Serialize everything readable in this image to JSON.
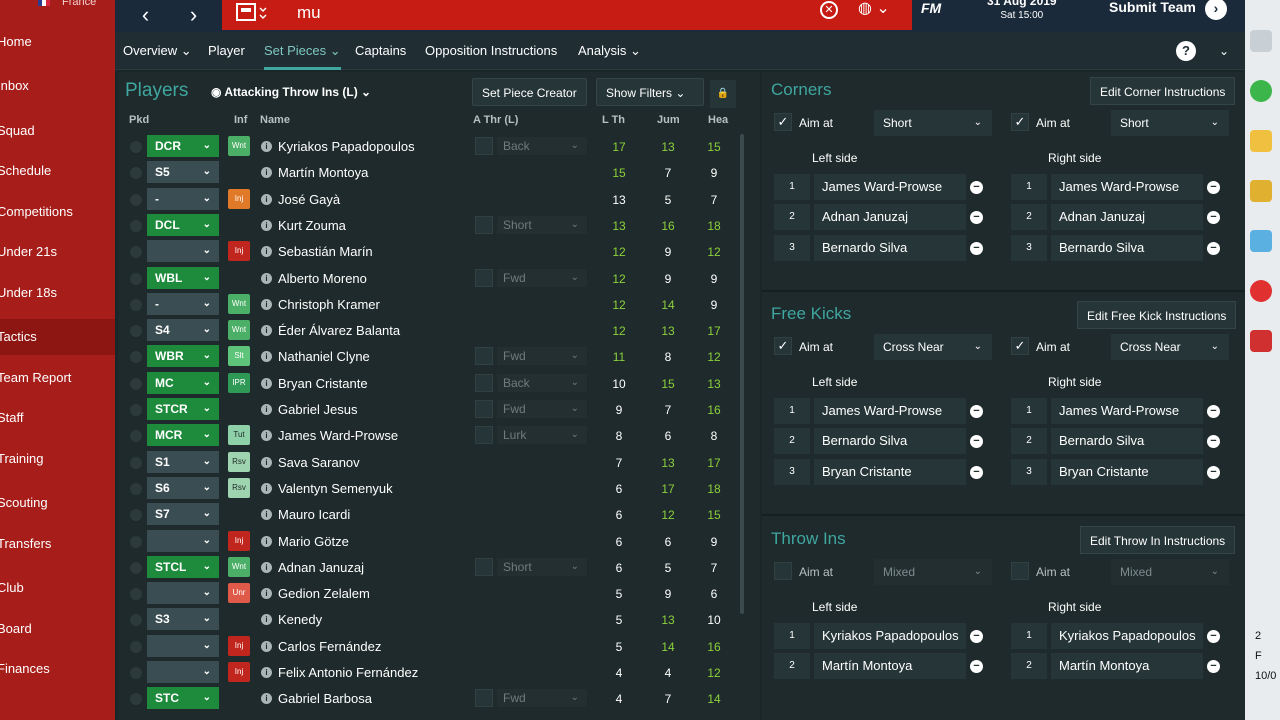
{
  "sidebar": {
    "nation": "France",
    "items": [
      "Home",
      "Inbox",
      "Squad",
      "Schedule",
      "Competitions",
      "Under 21s",
      "Under 18s",
      "Tactics",
      "Team Report",
      "Staff",
      "Training",
      "Scouting",
      "Transfers",
      "Club",
      "Board",
      "Finances"
    ],
    "active": "Tactics"
  },
  "topbar": {
    "back": "‹",
    "forward": "›",
    "search_value": "mu",
    "fm": "FM",
    "date": "31 Aug 2019",
    "time": "Sat 15:00",
    "submit": "Submit Team"
  },
  "subnav": {
    "tabs": [
      "Overview",
      "Player",
      "Set Pieces",
      "Captains",
      "Opposition Instructions",
      "Analysis"
    ],
    "active": "Set Pieces",
    "help": "?"
  },
  "players": {
    "title": "Players",
    "view": "Attacking Throw Ins (L)",
    "set_piece_creator": "Set Piece Creator",
    "show_filters": "Show Filters",
    "headers": {
      "pkd": "Pkd",
      "inf": "Inf",
      "name": "Name",
      "athr": "A Thr (L)",
      "lth": "L Th",
      "jum": "Jum",
      "hea": "Hea"
    },
    "rows": [
      {
        "pos": "DCR",
        "pos_style": "g",
        "inf": "Wnt",
        "inf_style": "wnt",
        "name": "Kyriakos Papadopoulos",
        "athr": "Back",
        "lth": 17,
        "jum": 13,
        "hea": 15,
        "c": [
          "g",
          "g",
          "g"
        ]
      },
      {
        "pos": "S5",
        "pos_style": "s",
        "inf": "",
        "inf_style": "",
        "name": "Martín Montoya",
        "athr": "",
        "lth": 15,
        "jum": 7,
        "hea": 9,
        "c": [
          "g",
          "w",
          "w"
        ]
      },
      {
        "pos": "-",
        "pos_style": "s",
        "inf": "Inj",
        "inf_style": "inj2",
        "name": "José Gayà",
        "athr": "",
        "lth": 13,
        "jum": 5,
        "hea": 7,
        "c": [
          "w",
          "w",
          "w"
        ]
      },
      {
        "pos": "DCL",
        "pos_style": "g",
        "inf": "",
        "inf_style": "",
        "name": "Kurt Zouma",
        "athr": "Short",
        "lth": 13,
        "jum": 16,
        "hea": 18,
        "c": [
          "g",
          "g",
          "g"
        ]
      },
      {
        "pos": "",
        "pos_style": "s",
        "inf": "Inj",
        "inf_style": "inj",
        "name": "Sebastián Marín",
        "athr": "",
        "lth": 12,
        "jum": 9,
        "hea": 12,
        "c": [
          "g",
          "w",
          "g"
        ]
      },
      {
        "pos": "WBL",
        "pos_style": "g",
        "inf": "",
        "inf_style": "",
        "name": "Alberto Moreno",
        "athr": "Fwd",
        "lth": 12,
        "jum": 9,
        "hea": 9,
        "c": [
          "g",
          "w",
          "w"
        ]
      },
      {
        "pos": "-",
        "pos_style": "s",
        "inf": "Wnt",
        "inf_style": "wnt",
        "name": "Christoph Kramer",
        "athr": "",
        "lth": 12,
        "jum": 14,
        "hea": 9,
        "c": [
          "g",
          "g",
          "w"
        ]
      },
      {
        "pos": "S4",
        "pos_style": "s",
        "inf": "Wnt",
        "inf_style": "wnt",
        "name": "Éder Álvarez Balanta",
        "athr": "",
        "lth": 12,
        "jum": 13,
        "hea": 17,
        "c": [
          "g",
          "g",
          "g"
        ]
      },
      {
        "pos": "WBR",
        "pos_style": "g",
        "inf": "Slt",
        "inf_style": "slt",
        "name": "Nathaniel Clyne",
        "athr": "Fwd",
        "lth": 11,
        "jum": 8,
        "hea": 12,
        "c": [
          "g",
          "w",
          "g"
        ]
      },
      {
        "pos": "MC",
        "pos_style": "g",
        "inf": "IPR",
        "inf_style": "ipr",
        "name": "Bryan Cristante",
        "athr": "Back",
        "lth": 10,
        "jum": 15,
        "hea": 13,
        "c": [
          "w",
          "g",
          "g"
        ]
      },
      {
        "pos": "STCR",
        "pos_style": "g",
        "inf": "",
        "inf_style": "",
        "name": "Gabriel Jesus",
        "athr": "Fwd",
        "lth": 9,
        "jum": 7,
        "hea": 16,
        "c": [
          "w",
          "w",
          "g"
        ]
      },
      {
        "pos": "MCR",
        "pos_style": "g",
        "inf": "Tut",
        "inf_style": "tut",
        "name": "James Ward-Prowse",
        "athr": "Lurk",
        "lth": 8,
        "jum": 6,
        "hea": 8,
        "c": [
          "w",
          "w",
          "w"
        ]
      },
      {
        "pos": "S1",
        "pos_style": "s",
        "inf": "Rsv",
        "inf_style": "rsv",
        "name": "Sava Saranov",
        "athr": "",
        "lth": 7,
        "jum": 13,
        "hea": 17,
        "c": [
          "w",
          "g",
          "g"
        ]
      },
      {
        "pos": "S6",
        "pos_style": "s",
        "inf": "Rsv",
        "inf_style": "rsv",
        "name": "Valentyn Semenyuk",
        "athr": "",
        "lth": 6,
        "jum": 17,
        "hea": 18,
        "c": [
          "w",
          "g",
          "g"
        ]
      },
      {
        "pos": "S7",
        "pos_style": "s",
        "inf": "",
        "inf_style": "",
        "name": "Mauro Icardi",
        "athr": "",
        "lth": 6,
        "jum": 12,
        "hea": 15,
        "c": [
          "w",
          "g",
          "g"
        ]
      },
      {
        "pos": "",
        "pos_style": "s",
        "inf": "Inj",
        "inf_style": "inj",
        "name": "Mario Götze",
        "athr": "",
        "lth": 6,
        "jum": 6,
        "hea": 9,
        "c": [
          "w",
          "w",
          "w"
        ]
      },
      {
        "pos": "STCL",
        "pos_style": "g",
        "inf": "Wnt",
        "inf_style": "wnt",
        "name": "Adnan Januzaj",
        "athr": "Short",
        "lth": 6,
        "jum": 5,
        "hea": 7,
        "c": [
          "w",
          "w",
          "w"
        ]
      },
      {
        "pos": "",
        "pos_style": "s",
        "inf": "Unr",
        "inf_style": "unr",
        "name": "Gedion Zelalem",
        "athr": "",
        "lth": 5,
        "jum": 9,
        "hea": 6,
        "c": [
          "w",
          "w",
          "w"
        ]
      },
      {
        "pos": "S3",
        "pos_style": "s",
        "inf": "",
        "inf_style": "",
        "name": "Kenedy",
        "athr": "",
        "lth": 5,
        "jum": 13,
        "hea": 10,
        "c": [
          "w",
          "g",
          "w"
        ]
      },
      {
        "pos": "",
        "pos_style": "s",
        "inf": "Inj",
        "inf_style": "inj",
        "name": "Carlos Fernández",
        "athr": "",
        "lth": 5,
        "jum": 14,
        "hea": 16,
        "c": [
          "w",
          "g",
          "g"
        ]
      },
      {
        "pos": "",
        "pos_style": "s",
        "inf": "Inj",
        "inf_style": "inj",
        "name": "Felix Antonio Fernández",
        "athr": "",
        "lth": 4,
        "jum": 4,
        "hea": 12,
        "c": [
          "w",
          "w",
          "g"
        ]
      },
      {
        "pos": "STC",
        "pos_style": "g",
        "inf": "",
        "inf_style": "",
        "name": "Gabriel Barbosa",
        "athr": "Fwd",
        "lth": 4,
        "jum": 7,
        "hea": 14,
        "c": [
          "w",
          "w",
          "g"
        ]
      }
    ]
  },
  "setpieces": [
    {
      "title": "Corners",
      "edit": "Edit Corner Instructions",
      "aim_label": "Aim at",
      "left_aim": "Short",
      "right_aim": "Short",
      "checked": true,
      "left_label": "Left side",
      "right_label": "Right side",
      "left": [
        "James Ward-Prowse",
        "Adnan Januzaj",
        "Bernardo Silva"
      ],
      "right": [
        "James Ward-Prowse",
        "Adnan Januzaj",
        "Bernardo Silva"
      ]
    },
    {
      "title": "Free Kicks",
      "edit": "Edit Free Kick Instructions",
      "aim_label": "Aim at",
      "left_aim": "Cross Near",
      "right_aim": "Cross Near",
      "checked": true,
      "left_label": "Left side",
      "right_label": "Right side",
      "left": [
        "James Ward-Prowse",
        "Bernardo Silva",
        "Bryan Cristante"
      ],
      "right": [
        "James Ward-Prowse",
        "Bernardo Silva",
        "Bryan Cristante"
      ]
    },
    {
      "title": "Throw Ins",
      "edit": "Edit Throw In Instructions",
      "aim_label": "Aim at",
      "left_aim": "Mixed",
      "right_aim": "Mixed",
      "checked": false,
      "left_label": "Left side",
      "right_label": "Right side",
      "left": [
        "Kyriakos Papadopoulos",
        "Martín Montoya"
      ],
      "right": [
        "Kyriakos Papadopoulos",
        "Martín Montoya"
      ]
    }
  ],
  "tray": {
    "line1": "2",
    "line2": "F",
    "line3": "10/0"
  },
  "colors": {
    "accent": "#3fa6a0",
    "sidebar": "#a71d1a",
    "search": "#c71c14",
    "green": "#8cd13c"
  }
}
